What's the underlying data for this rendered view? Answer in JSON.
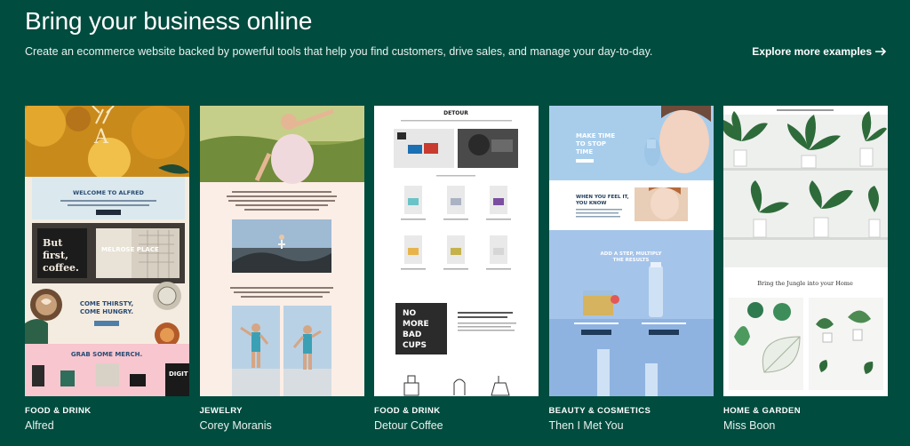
{
  "header": {
    "title": "Bring your business online",
    "subtitle": "Create an ecommerce website backed by powerful tools that help you find customers, drive sales, and manage your day-to-day.",
    "explore_label": "Explore more examples",
    "explore_icon": "arrow-right-icon"
  },
  "colors": {
    "background": "#004c3f",
    "text": "#ffffff"
  },
  "cards": [
    {
      "category": "FOOD & DRINK",
      "name": "Alfred",
      "screenshot": {
        "welcome": "WELCOME TO ALFRED",
        "window_line1": "But",
        "window_line2": "first,",
        "window_line3": "coffee.",
        "sign": "MELROSE PLACE",
        "promo_line1": "COME THIRSTY,",
        "promo_line2": "COME HUNGRY.",
        "merch": "GRAB SOME MERCH.",
        "gift": "DIGIT GIFTC"
      }
    },
    {
      "category": "JEWELRY",
      "name": "Corey Moranis",
      "screenshot": {}
    },
    {
      "category": "FOOD & DRINK",
      "name": "Detour Coffee",
      "screenshot": {
        "logo": "DETOUR",
        "cup_line1": "NO",
        "cup_line2": "MORE",
        "cup_line3": "BAD",
        "cup_line4": "CUPS"
      }
    },
    {
      "category": "BEAUTY & COSMETICS",
      "name": "Then I Met You",
      "screenshot": {
        "hero_line1": "MAKE TIME",
        "hero_line2": "TO STOP",
        "hero_line3": "TIME",
        "feel_line1": "WHEN YOU FEEL IT,",
        "feel_line2": "YOU KNOW",
        "step_line1": "ADD A STEP, MULTIPLY",
        "step_line2": "THE RESULTS"
      }
    },
    {
      "category": "HOME & GARDEN",
      "name": "Miss Boon",
      "screenshot": {
        "tagline": "Bring the Jungle into your Home"
      }
    }
  ]
}
